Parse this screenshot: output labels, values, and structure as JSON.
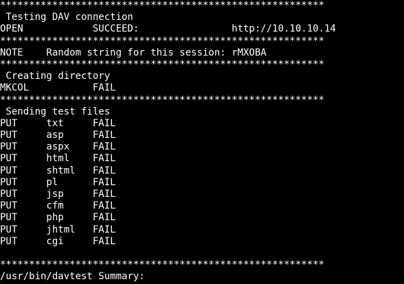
{
  "terminal": {
    "lines": [
      "********************************************************",
      " Testing DAV connection",
      "OPEN            SUCCEED:                http://10.10.10.14",
      "********************************************************",
      "NOTE    Random string for this session: rMXOBA",
      "********************************************************",
      " Creating directory",
      "MKCOL           FAIL",
      "********************************************************",
      " Sending test files",
      "PUT     txt     FAIL",
      "PUT     asp     FAIL",
      "PUT     aspx    FAIL",
      "PUT     html    FAIL",
      "PUT     shtml   FAIL",
      "PUT     pl      FAIL",
      "PUT     jsp     FAIL",
      "PUT     cfm     FAIL",
      "PUT     php     FAIL",
      "PUT     jhtml   FAIL",
      "PUT     cgi     FAIL",
      "",
      "********************************************************",
      "/usr/bin/davtest Summary:"
    ]
  }
}
